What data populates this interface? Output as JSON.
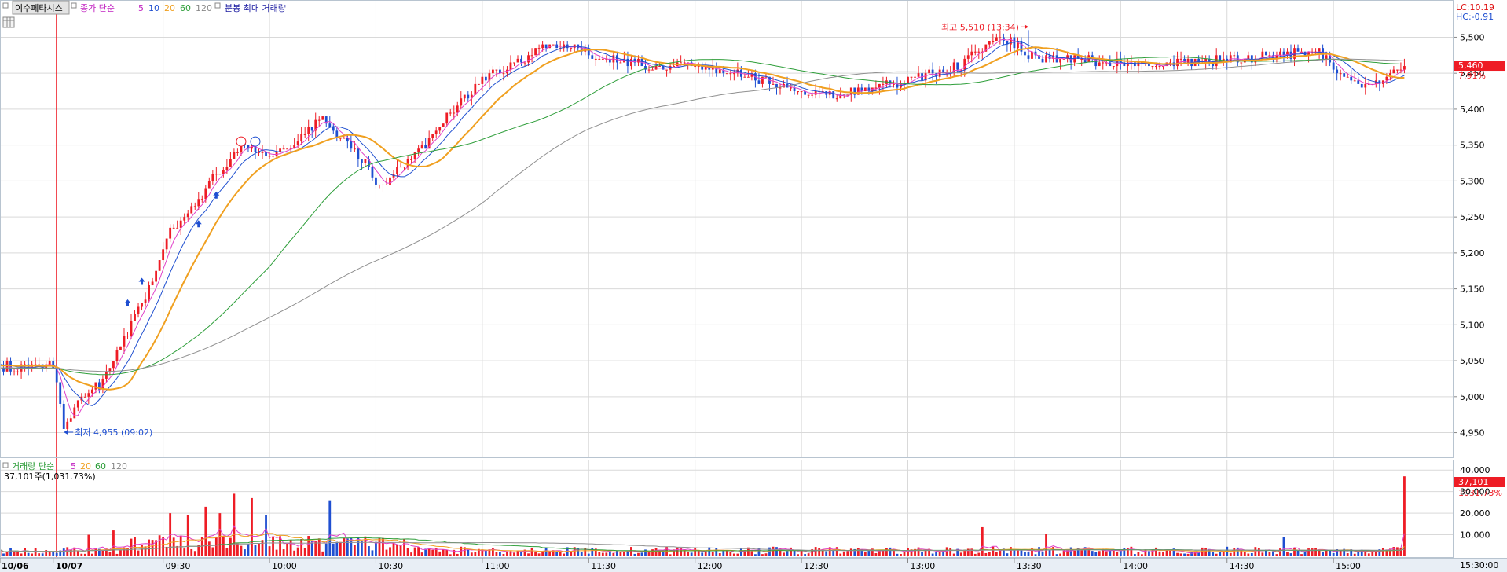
{
  "header": {
    "title": "이수페타시스",
    "price_label": "종가 단순",
    "ma_periods": [
      "5",
      "10",
      "20",
      "60",
      "120"
    ],
    "extra_label": "분봉 최대 거래량"
  },
  "volume_header": {
    "label": "거래량 단순",
    "ma_periods": [
      "5",
      "20",
      "60",
      "120"
    ],
    "current_text": "37,101주(1,031.73%)"
  },
  "right_panel": {
    "lc": "LC:10.19",
    "hc": "HC:-0.91",
    "price_badge": "5,460",
    "pct_badge": "7.91%",
    "vol_badge": "37,101",
    "vol_pct_badge": "1031.73%",
    "time_badge": "15:30:00"
  },
  "colors": {
    "up": "#ee1c25",
    "down": "#1f4fd1",
    "ma5": "#e040c8",
    "ma10": "#2050d0",
    "ma20": "#f0a020",
    "ma60": "#2e9e3a",
    "ma120": "#909090",
    "grid": "#d9d9d9",
    "axis_bg": "#e8eef5"
  },
  "chart_data": {
    "type": "candlestick",
    "symbol": "이수페타시스",
    "y_ticks": [
      4950,
      5000,
      5050,
      5100,
      5150,
      5200,
      5250,
      5300,
      5350,
      5400,
      5450,
      5500
    ],
    "y_tick_labels": [
      "4,950",
      "5,000",
      "5,050",
      "5,100",
      "5,150",
      "5,200",
      "5,250",
      "5,300",
      "5,350",
      "5,400",
      "5,450",
      "5,500"
    ],
    "ylim": [
      4920,
      5530
    ],
    "x_labels": [
      "10/06",
      "10/07",
      "09:30",
      "10:00",
      "10:30",
      "11:00",
      "11:30",
      "12:00",
      "12:30",
      "13:00",
      "13:30",
      "14:00",
      "14:30",
      "15:00"
    ],
    "x_label_minutes": [
      -16,
      -1,
      30,
      60,
      90,
      120,
      150,
      180,
      210,
      240,
      270,
      300,
      330,
      360
    ],
    "x_range_minutes": [
      -16,
      385
    ],
    "date_divider_minute": -1,
    "price_key_points": [
      {
        "m": -16,
        "p": 5040
      },
      {
        "m": -1,
        "p": 5045
      },
      {
        "m": 2,
        "p": 4955
      },
      {
        "m": 7,
        "p": 5000
      },
      {
        "m": 13,
        "p": 5020
      },
      {
        "m": 20,
        "p": 5090
      },
      {
        "m": 26,
        "p": 5150
      },
      {
        "m": 32,
        "p": 5230
      },
      {
        "m": 38,
        "p": 5260
      },
      {
        "m": 45,
        "p": 5310
      },
      {
        "m": 52,
        "p": 5350
      },
      {
        "m": 58,
        "p": 5340
      },
      {
        "m": 65,
        "p": 5340
      },
      {
        "m": 70,
        "p": 5360
      },
      {
        "m": 74,
        "p": 5390
      },
      {
        "m": 80,
        "p": 5360
      },
      {
        "m": 86,
        "p": 5330
      },
      {
        "m": 91,
        "p": 5290
      },
      {
        "m": 97,
        "p": 5320
      },
      {
        "m": 104,
        "p": 5350
      },
      {
        "m": 112,
        "p": 5400
      },
      {
        "m": 120,
        "p": 5440
      },
      {
        "m": 130,
        "p": 5470
      },
      {
        "m": 140,
        "p": 5490
      },
      {
        "m": 148,
        "p": 5480
      },
      {
        "m": 156,
        "p": 5470
      },
      {
        "m": 165,
        "p": 5460
      },
      {
        "m": 180,
        "p": 5460
      },
      {
        "m": 195,
        "p": 5450
      },
      {
        "m": 205,
        "p": 5430
      },
      {
        "m": 215,
        "p": 5420
      },
      {
        "m": 225,
        "p": 5425
      },
      {
        "m": 240,
        "p": 5440
      },
      {
        "m": 255,
        "p": 5460
      },
      {
        "m": 265,
        "p": 5500
      },
      {
        "m": 270,
        "p": 5490
      },
      {
        "m": 276,
        "p": 5470
      },
      {
        "m": 290,
        "p": 5470
      },
      {
        "m": 300,
        "p": 5460
      },
      {
        "m": 315,
        "p": 5465
      },
      {
        "m": 330,
        "p": 5470
      },
      {
        "m": 345,
        "p": 5475
      },
      {
        "m": 356,
        "p": 5485
      },
      {
        "m": 362,
        "p": 5450
      },
      {
        "m": 370,
        "p": 5430
      },
      {
        "m": 380,
        "p": 5460
      }
    ],
    "moving_averages": [
      {
        "name": "5",
        "period": 5
      },
      {
        "name": "10",
        "period": 10
      },
      {
        "name": "20",
        "period": 20
      },
      {
        "name": "60",
        "period": 60
      },
      {
        "name": "120",
        "period": 120
      }
    ],
    "annotations": [
      {
        "id": "high",
        "text": "최고 5,510 (13:34)",
        "minute": 274,
        "price": 5510
      },
      {
        "id": "low",
        "text": "최저 4,955 (09:02)",
        "minute": 2,
        "price": 4955
      }
    ],
    "current_price": 5460,
    "volume": {
      "y_ticks": [
        10000,
        20000,
        30000,
        40000
      ],
      "y_tick_labels": [
        "10,000",
        "20,000",
        "30,000",
        "40,000"
      ],
      "ylim": [
        0,
        43000
      ],
      "last_bar": 37101,
      "spike_bars": [
        {
          "m": 9,
          "v": 10000
        },
        {
          "m": 16,
          "v": 12000
        },
        {
          "m": 32,
          "v": 20000
        },
        {
          "m": 37,
          "v": 19000
        },
        {
          "m": 42,
          "v": 23000
        },
        {
          "m": 46,
          "v": 20000
        },
        {
          "m": 50,
          "v": 29000
        },
        {
          "m": 55,
          "v": 27000
        },
        {
          "m": 59,
          "v": 19000
        },
        {
          "m": 77,
          "v": 26000
        },
        {
          "m": 261,
          "v": 13500
        },
        {
          "m": 279,
          "v": 10500
        },
        {
          "m": 346,
          "v": 9000
        }
      ]
    }
  }
}
